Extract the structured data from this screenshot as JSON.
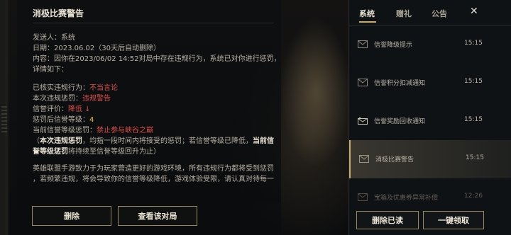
{
  "mail": {
    "title": "消极比赛警告",
    "sender_line": "发送人：系统",
    "date_label": "日期：",
    "date_value": "2023.06.02（30天后自动删除）",
    "content_line1": "内容：因你在2023/06/02 14:52对局中存在违规行为，系统已对你进行惩罚，",
    "content_line2": "详情如下：",
    "violation_label": "已核实违规行为：",
    "violation_value": "不当言论",
    "penalty_label": "本次违规惩罚：",
    "penalty_value": "违规警告",
    "credit_label": "信誉评价：",
    "credit_value": "降低 ↓",
    "level_after_label": "惩罚后信誉等级：",
    "level_after_value": "4",
    "level_penalty_label": "当前信誉等级惩罚：",
    "level_penalty_value": "禁止参与峡谷之巅",
    "note_open": "（",
    "note_bold1": "本次违规惩罚",
    "note_mid": "，均指一段时间内将接受的惩罚；若信誉等级已降低，",
    "note_bold2": "当前信誉等级惩罚",
    "note_end": "将持续至信誉等级回升为止）",
    "footer_line1": "英雄联盟手游致力于为玩家营造更好的游戏环境，所有违规行为都将受到惩罚",
    "footer_line2": "，若频繁违规，将会导致你的信誉等级降低，游戏体验受限，请认真对待每一",
    "delete_button": "删除",
    "view_match_button": "查看该对局"
  },
  "side": {
    "tabs": [
      {
        "label": "系统",
        "active": true
      },
      {
        "label": "赠礼",
        "active": false
      },
      {
        "label": "公告",
        "active": false
      }
    ],
    "close_icon": "✕",
    "items": [
      {
        "label": "信誉降级提示",
        "time": "15:15",
        "icon": "mail-icon"
      },
      {
        "label": "信誉积分扣减通知",
        "time": "15:15",
        "icon": "mail-icon"
      },
      {
        "label": "信誉奖励回收通知",
        "time": "15:15",
        "icon": "mail-gift-icon"
      },
      {
        "label": "消极比赛警告",
        "time": "15:15",
        "icon": "mail-icon",
        "active": true
      },
      {
        "label": "宝箱及优惠券异常补偿",
        "time": "12:26",
        "icon": "mail-icon"
      }
    ],
    "delete_read_button": "删除已读",
    "claim_all_button": "一键领取"
  },
  "colors": {
    "accent_gold": "#c8aa6e",
    "warning_red": "#e0504a",
    "level_yellow": "#e8c04a"
  }
}
